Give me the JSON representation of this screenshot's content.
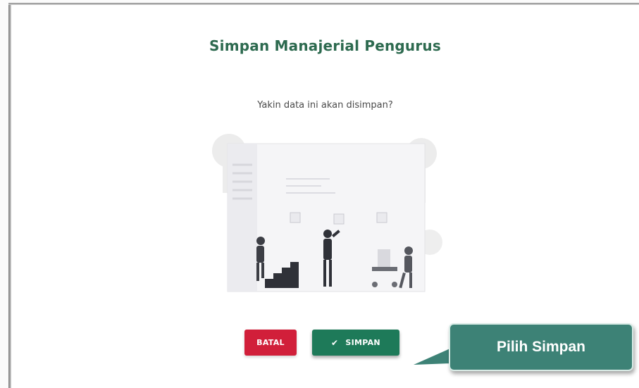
{
  "dialog": {
    "title": "Simpan Manajerial Pengurus",
    "message": "Yakin data ini akan disimpan?"
  },
  "buttons": {
    "cancel_label": "BATAL",
    "save_label": "SIMPAN",
    "save_icon": "check-icon"
  },
  "callout": {
    "text": "Pilih Simpan"
  },
  "colors": {
    "title": "#2d6a4f",
    "cancel": "#d11f3a",
    "save": "#1e7a59",
    "callout": "#3d8276"
  }
}
